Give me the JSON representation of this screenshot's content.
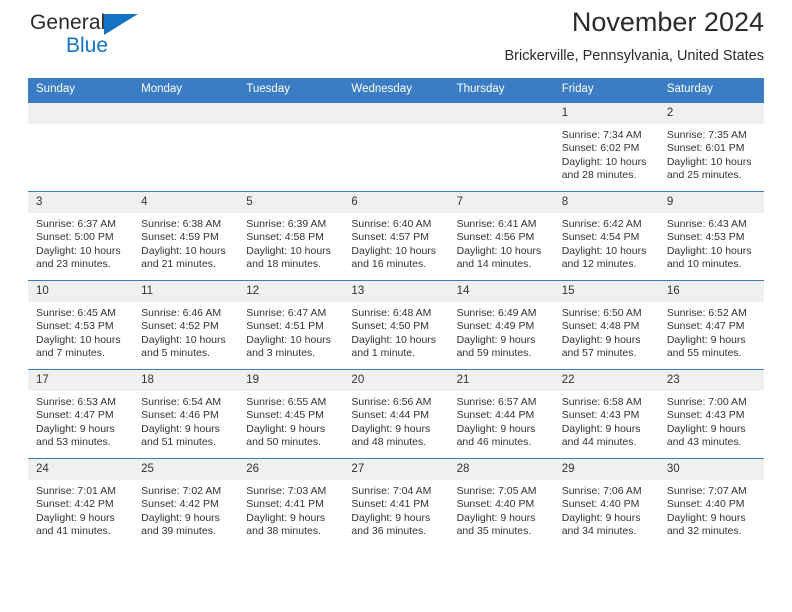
{
  "brand": {
    "name_top": "General",
    "name_bottom": "Blue",
    "triangle_color": "#1273c4"
  },
  "header": {
    "title": "November 2024",
    "location": "Brickerville, Pennsylvania, United States"
  },
  "theme": {
    "header_blue": "#3a7dc4",
    "daynum_band": "#f0f0f0",
    "text": "#333333"
  },
  "calendar": {
    "weekday_headers": [
      "Sunday",
      "Monday",
      "Tuesday",
      "Wednesday",
      "Thursday",
      "Friday",
      "Saturday"
    ],
    "weeks": [
      [
        {
          "day": "",
          "sunrise": "",
          "sunset": "",
          "daylight": ""
        },
        {
          "day": "",
          "sunrise": "",
          "sunset": "",
          "daylight": ""
        },
        {
          "day": "",
          "sunrise": "",
          "sunset": "",
          "daylight": ""
        },
        {
          "day": "",
          "sunrise": "",
          "sunset": "",
          "daylight": ""
        },
        {
          "day": "",
          "sunrise": "",
          "sunset": "",
          "daylight": ""
        },
        {
          "day": "1",
          "sunrise": "Sunrise: 7:34 AM",
          "sunset": "Sunset: 6:02 PM",
          "daylight": "Daylight: 10 hours and 28 minutes."
        },
        {
          "day": "2",
          "sunrise": "Sunrise: 7:35 AM",
          "sunset": "Sunset: 6:01 PM",
          "daylight": "Daylight: 10 hours and 25 minutes."
        }
      ],
      [
        {
          "day": "3",
          "sunrise": "Sunrise: 6:37 AM",
          "sunset": "Sunset: 5:00 PM",
          "daylight": "Daylight: 10 hours and 23 minutes."
        },
        {
          "day": "4",
          "sunrise": "Sunrise: 6:38 AM",
          "sunset": "Sunset: 4:59 PM",
          "daylight": "Daylight: 10 hours and 21 minutes."
        },
        {
          "day": "5",
          "sunrise": "Sunrise: 6:39 AM",
          "sunset": "Sunset: 4:58 PM",
          "daylight": "Daylight: 10 hours and 18 minutes."
        },
        {
          "day": "6",
          "sunrise": "Sunrise: 6:40 AM",
          "sunset": "Sunset: 4:57 PM",
          "daylight": "Daylight: 10 hours and 16 minutes."
        },
        {
          "day": "7",
          "sunrise": "Sunrise: 6:41 AM",
          "sunset": "Sunset: 4:56 PM",
          "daylight": "Daylight: 10 hours and 14 minutes."
        },
        {
          "day": "8",
          "sunrise": "Sunrise: 6:42 AM",
          "sunset": "Sunset: 4:54 PM",
          "daylight": "Daylight: 10 hours and 12 minutes."
        },
        {
          "day": "9",
          "sunrise": "Sunrise: 6:43 AM",
          "sunset": "Sunset: 4:53 PM",
          "daylight": "Daylight: 10 hours and 10 minutes."
        }
      ],
      [
        {
          "day": "10",
          "sunrise": "Sunrise: 6:45 AM",
          "sunset": "Sunset: 4:53 PM",
          "daylight": "Daylight: 10 hours and 7 minutes."
        },
        {
          "day": "11",
          "sunrise": "Sunrise: 6:46 AM",
          "sunset": "Sunset: 4:52 PM",
          "daylight": "Daylight: 10 hours and 5 minutes."
        },
        {
          "day": "12",
          "sunrise": "Sunrise: 6:47 AM",
          "sunset": "Sunset: 4:51 PM",
          "daylight": "Daylight: 10 hours and 3 minutes."
        },
        {
          "day": "13",
          "sunrise": "Sunrise: 6:48 AM",
          "sunset": "Sunset: 4:50 PM",
          "daylight": "Daylight: 10 hours and 1 minute."
        },
        {
          "day": "14",
          "sunrise": "Sunrise: 6:49 AM",
          "sunset": "Sunset: 4:49 PM",
          "daylight": "Daylight: 9 hours and 59 minutes."
        },
        {
          "day": "15",
          "sunrise": "Sunrise: 6:50 AM",
          "sunset": "Sunset: 4:48 PM",
          "daylight": "Daylight: 9 hours and 57 minutes."
        },
        {
          "day": "16",
          "sunrise": "Sunrise: 6:52 AM",
          "sunset": "Sunset: 4:47 PM",
          "daylight": "Daylight: 9 hours and 55 minutes."
        }
      ],
      [
        {
          "day": "17",
          "sunrise": "Sunrise: 6:53 AM",
          "sunset": "Sunset: 4:47 PM",
          "daylight": "Daylight: 9 hours and 53 minutes."
        },
        {
          "day": "18",
          "sunrise": "Sunrise: 6:54 AM",
          "sunset": "Sunset: 4:46 PM",
          "daylight": "Daylight: 9 hours and 51 minutes."
        },
        {
          "day": "19",
          "sunrise": "Sunrise: 6:55 AM",
          "sunset": "Sunset: 4:45 PM",
          "daylight": "Daylight: 9 hours and 50 minutes."
        },
        {
          "day": "20",
          "sunrise": "Sunrise: 6:56 AM",
          "sunset": "Sunset: 4:44 PM",
          "daylight": "Daylight: 9 hours and 48 minutes."
        },
        {
          "day": "21",
          "sunrise": "Sunrise: 6:57 AM",
          "sunset": "Sunset: 4:44 PM",
          "daylight": "Daylight: 9 hours and 46 minutes."
        },
        {
          "day": "22",
          "sunrise": "Sunrise: 6:58 AM",
          "sunset": "Sunset: 4:43 PM",
          "daylight": "Daylight: 9 hours and 44 minutes."
        },
        {
          "day": "23",
          "sunrise": "Sunrise: 7:00 AM",
          "sunset": "Sunset: 4:43 PM",
          "daylight": "Daylight: 9 hours and 43 minutes."
        }
      ],
      [
        {
          "day": "24",
          "sunrise": "Sunrise: 7:01 AM",
          "sunset": "Sunset: 4:42 PM",
          "daylight": "Daylight: 9 hours and 41 minutes."
        },
        {
          "day": "25",
          "sunrise": "Sunrise: 7:02 AM",
          "sunset": "Sunset: 4:42 PM",
          "daylight": "Daylight: 9 hours and 39 minutes."
        },
        {
          "day": "26",
          "sunrise": "Sunrise: 7:03 AM",
          "sunset": "Sunset: 4:41 PM",
          "daylight": "Daylight: 9 hours and 38 minutes."
        },
        {
          "day": "27",
          "sunrise": "Sunrise: 7:04 AM",
          "sunset": "Sunset: 4:41 PM",
          "daylight": "Daylight: 9 hours and 36 minutes."
        },
        {
          "day": "28",
          "sunrise": "Sunrise: 7:05 AM",
          "sunset": "Sunset: 4:40 PM",
          "daylight": "Daylight: 9 hours and 35 minutes."
        },
        {
          "day": "29",
          "sunrise": "Sunrise: 7:06 AM",
          "sunset": "Sunset: 4:40 PM",
          "daylight": "Daylight: 9 hours and 34 minutes."
        },
        {
          "day": "30",
          "sunrise": "Sunrise: 7:07 AM",
          "sunset": "Sunset: 4:40 PM",
          "daylight": "Daylight: 9 hours and 32 minutes."
        }
      ]
    ]
  }
}
